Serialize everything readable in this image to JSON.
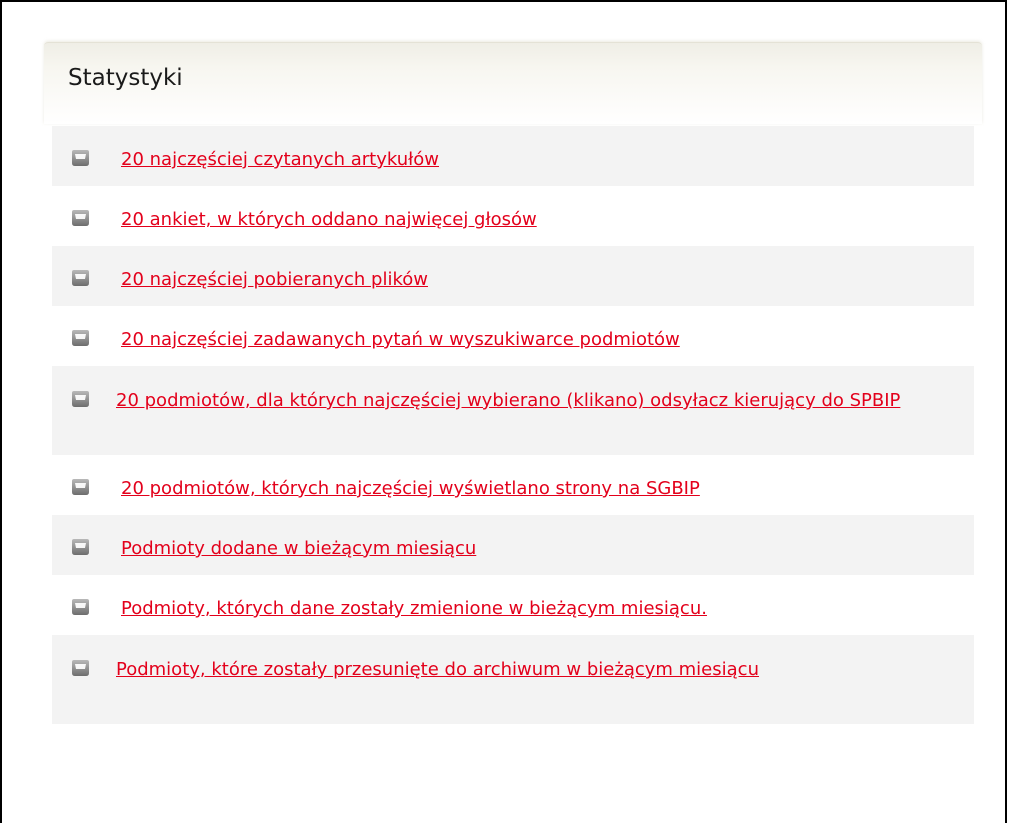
{
  "panel": {
    "title": "Statystyki"
  },
  "links": [
    {
      "label": "20 najczęściej czytanych artykułów"
    },
    {
      "label": "20 ankiet, w których oddano najwięcej głosów"
    },
    {
      "label": "20 najczęściej pobieranych plików"
    },
    {
      "label": "20 najczęściej zadawanych pytań w wyszukiwarce podmiotów"
    },
    {
      "label": "20 podmiotów, dla których najczęściej wybierano (klikano) odsyłacz kierujący do SPBIP"
    },
    {
      "label": "20 podmiotów, których najczęściej wyświetlano strony na SGBIP"
    },
    {
      "label": "Podmioty dodane w bieżącym miesiącu"
    },
    {
      "label": "Podmioty, których dane zostały zmienione w bieżącym miesiącu."
    },
    {
      "label": "Podmioty, które zostały przesunięte do archiwum w bieżącym miesiącu"
    }
  ],
  "colors": {
    "link": "#e3001b",
    "row_shade": "#f3f3f3",
    "icon": "#8a8a8a"
  },
  "icons": {
    "bullet": "folder-bullet-icon"
  }
}
